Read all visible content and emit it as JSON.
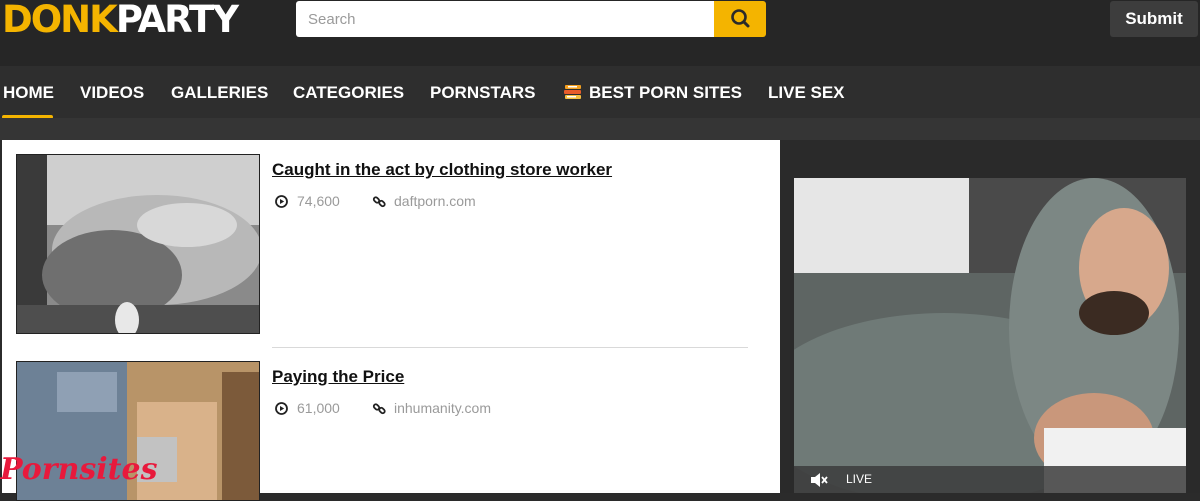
{
  "header": {
    "logo_part1": "DONK",
    "logo_part2": "PARTY",
    "search_placeholder": "Search",
    "search_icon": "magnifier-icon",
    "submit_label": "Submit"
  },
  "nav": {
    "items": [
      {
        "label": "HOME"
      },
      {
        "label": "VIDEOS"
      },
      {
        "label": "GALLERIES"
      },
      {
        "label": "CATEGORIES"
      },
      {
        "label": "PORNSTARS"
      },
      {
        "label": "BEST PORN SITES"
      },
      {
        "label": "LIVE SEX"
      }
    ],
    "active": "HOME"
  },
  "videos": [
    {
      "title": "Caught in the act by clothing store worker",
      "views": "74,600",
      "source": "daftporn.com"
    },
    {
      "title": "Paying the Price",
      "views": "61,000",
      "source": "inhumanity.com"
    }
  ],
  "live": {
    "label": "LIVE",
    "mute_icon": "muted-speaker-icon"
  },
  "watermark": "Pornsites",
  "colors": {
    "accent": "#f4b400",
    "background": "#2b2b2b",
    "watermark": "#e8193c"
  }
}
